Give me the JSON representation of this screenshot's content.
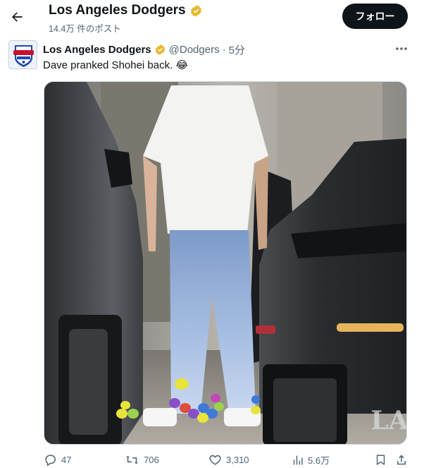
{
  "header": {
    "title": "Los Angeles Dodgers",
    "post_count": "14.4万 件のポスト",
    "follow_label": "フォロー"
  },
  "post": {
    "author_name": "Los Angeles Dodgers",
    "handle": "@Dodgers",
    "separator": "·",
    "time": "5分",
    "text": "Dave pranked Shohei back. 😂",
    "media_watermark": "LA"
  },
  "actions": {
    "replies": "47",
    "reposts": "706",
    "likes": "3,310",
    "views": "5.6万"
  },
  "colors": {
    "text_primary": "#0f1419",
    "text_secondary": "#536471",
    "verified_gold": "#e8b829",
    "follow_bg": "#0f1419"
  },
  "icons": [
    "back-arrow-icon",
    "verified-badge-icon",
    "more-icon",
    "reply-icon",
    "repost-icon",
    "like-icon",
    "views-icon",
    "bookmark-icon",
    "share-icon"
  ]
}
